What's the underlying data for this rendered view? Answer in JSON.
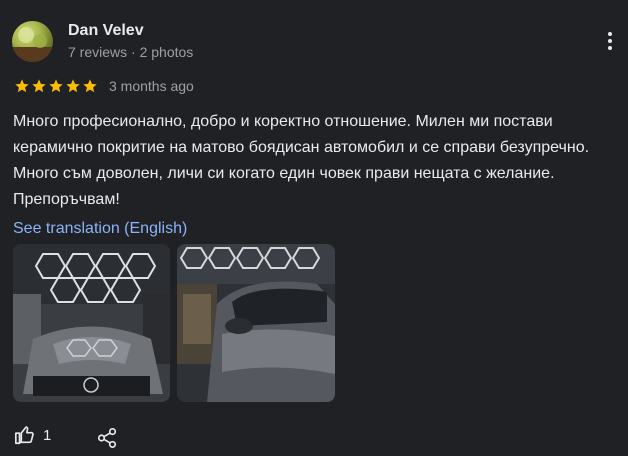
{
  "reviewer": {
    "name": "Dan Velev",
    "meta": "7 reviews · 2 photos"
  },
  "rating": {
    "stars": 5,
    "max": 5,
    "date": "3 months ago"
  },
  "review_text": "Много професионално, добро и коректно отношение. Милен ми постави керамично покритие на матово боядисан автомобил и се справи безупречно. Много съм доволен, личи си когато един човек прави нещата с желание. Препоръчвам!",
  "translate_link": "See translation (English)",
  "photos": [
    {
      "icon": "car-hood-photo"
    },
    {
      "icon": "car-side-photo"
    }
  ],
  "actions": {
    "like_count": "1",
    "like_icon": "thumbs-up-icon",
    "share_icon": "share-icon"
  },
  "colors": {
    "background": "#202124",
    "text": "#e8eaed",
    "secondary": "#9aa0a6",
    "link": "#8ab4f8",
    "star": "#fbbc04"
  }
}
